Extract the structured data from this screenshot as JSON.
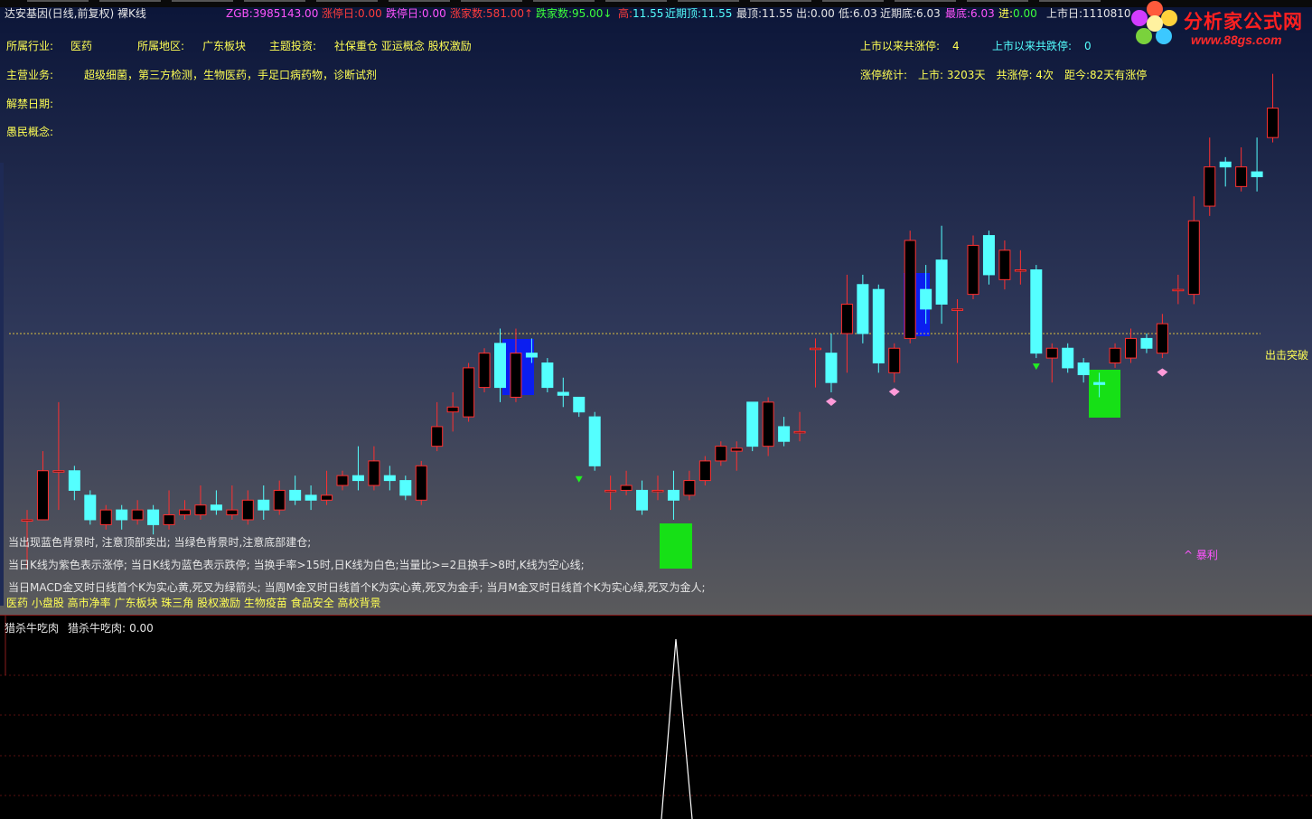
{
  "header": {
    "title": "达安基因(日线,前复权) 裸K线",
    "zgb_label": "ZGB:",
    "zgb_value": "3985143.00",
    "zt_label": "涨停日:",
    "zt_value": "0.00",
    "dt_label": "跌停日:",
    "dt_value": "0.00",
    "zjs_label": "涨家数:",
    "zjs_value": "581.00",
    "djs_label": "跌家数:",
    "djs_value": "95.00",
    "gao_label": "高:",
    "gao_value": "11.55",
    "jqd_label": "近期顶:",
    "jqd_value": "11.55",
    "zd_label": "最顶:",
    "zd_value": "11.55",
    "chu_label": "出:",
    "chu_value": "0.00",
    "di_label": "低:",
    "di_value": "6.03",
    "jqdi_label": "近期底:",
    "jqdi_value": "6.03",
    "zdi_label": "最底:",
    "zdi_value": "6.03",
    "jin_label": "进:",
    "jin_value": "0.00",
    "ssr_label": "上市日:",
    "ssr_value": "1110810"
  },
  "info": {
    "industry_label": "所属行业:",
    "industry_value": "医药",
    "region_label": "所属地区:",
    "region_value": "广东板块",
    "theme_label": "主题投资:",
    "theme_value": "社保重仓 亚运概念 股权激励",
    "business_label": "主营业务:",
    "business_value": "超级细菌，第三方检测，生物医药，手足口病药物，诊断试剂",
    "unban_label": "解禁日期:",
    "concept_label": "愚民概念:",
    "zt_total_label": "上市以来共涨停:",
    "zt_total_value": "4",
    "dt_total_label": "上市以来共跌停:",
    "dt_total_value": "0",
    "stat_label": "涨停统计:",
    "stat_listed": "上市: 3203天",
    "stat_count": "共涨停: 4次",
    "stat_since": "距今:82天有涨停"
  },
  "notes": {
    "line1": "当出现蓝色背景时, 注意顶部卖出; 当绿色背景时,注意底部建仓;",
    "line2": "当日K线为紫色表示涨停; 当日K线为蓝色表示跌停; 当换手率>15时,日K线为白色;当量比>=2且换手>8时,K线为空心线;",
    "line3": "当日MACD金叉时日线首个K为实心黄,死叉为绿箭头; 当周M金叉时日线首个K为实心黄,死叉为金手; 当月M金叉时日线首个K为实心绿,死叉为金人;",
    "tags": "医药 小盘股 高市净率 广东板块 珠三角 股权激励 生物疫苗 食品安全 高校背景",
    "breakout": "出击突破",
    "profit": "^ 暴利"
  },
  "indicator": {
    "title": "猎杀牛吃肉",
    "label": "猎杀牛吃肉:",
    "value": "0.00"
  },
  "logo": {
    "name": "分析家公式网",
    "url": "www.88gs.com"
  },
  "colors": {
    "up_body": "#000000",
    "up_line": "#ff3030",
    "down_body": "#54ffff",
    "limit_up": "#ff0000",
    "bg_top": "#0b1538",
    "bg_bottom": "#5a5a5c"
  },
  "chart_data": {
    "type": "candlestick",
    "breakout_level": 8.9,
    "candles": [
      {
        "o": 7.0,
        "c": 7.0,
        "h": 7.1,
        "l": 6.5
      },
      {
        "o": 7.0,
        "c": 7.5,
        "h": 7.7,
        "l": 7.0
      },
      {
        "o": 7.5,
        "c": 7.5,
        "h": 8.2,
        "l": 7.1
      },
      {
        "o": 7.5,
        "c": 7.3,
        "h": 7.55,
        "l": 7.2
      },
      {
        "o": 7.25,
        "c": 7.0,
        "h": 7.3,
        "l": 6.95
      },
      {
        "o": 6.95,
        "c": 7.1,
        "h": 7.15,
        "l": 6.9
      },
      {
        "o": 7.1,
        "c": 7.0,
        "h": 7.15,
        "l": 6.9
      },
      {
        "o": 7.0,
        "c": 7.1,
        "h": 7.2,
        "l": 6.95
      },
      {
        "o": 7.1,
        "c": 6.95,
        "h": 7.15,
        "l": 6.85
      },
      {
        "o": 6.95,
        "c": 7.05,
        "h": 7.3,
        "l": 6.9
      },
      {
        "o": 7.05,
        "c": 7.1,
        "h": 7.2,
        "l": 7.0
      },
      {
        "o": 7.05,
        "c": 7.15,
        "h": 7.35,
        "l": 7.0
      },
      {
        "o": 7.15,
        "c": 7.1,
        "h": 7.3,
        "l": 7.05
      },
      {
        "o": 7.05,
        "c": 7.1,
        "h": 7.35,
        "l": 7.0
      },
      {
        "o": 7.0,
        "c": 7.2,
        "h": 7.3,
        "l": 6.95
      },
      {
        "o": 7.2,
        "c": 7.1,
        "h": 7.35,
        "l": 7.0
      },
      {
        "o": 7.1,
        "c": 7.3,
        "h": 7.4,
        "l": 7.05
      },
      {
        "o": 7.3,
        "c": 7.2,
        "h": 7.45,
        "l": 7.15
      },
      {
        "o": 7.25,
        "c": 7.2,
        "h": 7.35,
        "l": 7.1
      },
      {
        "o": 7.2,
        "c": 7.25,
        "h": 7.5,
        "l": 7.15
      },
      {
        "o": 7.35,
        "c": 7.45,
        "h": 7.5,
        "l": 7.3
      },
      {
        "o": 7.45,
        "c": 7.4,
        "h": 7.75,
        "l": 7.3
      },
      {
        "o": 7.35,
        "c": 7.6,
        "h": 7.75,
        "l": 7.3
      },
      {
        "o": 7.45,
        "c": 7.4,
        "h": 7.55,
        "l": 7.3
      },
      {
        "o": 7.4,
        "c": 7.25,
        "h": 7.45,
        "l": 7.2
      },
      {
        "o": 7.2,
        "c": 7.55,
        "h": 7.6,
        "l": 7.15
      },
      {
        "o": 7.75,
        "c": 7.95,
        "h": 8.2,
        "l": 7.7
      },
      {
        "o": 8.1,
        "c": 8.15,
        "h": 8.3,
        "l": 7.9
      },
      {
        "o": 8.05,
        "c": 8.55,
        "h": 8.6,
        "l": 8.0
      },
      {
        "o": 8.35,
        "c": 8.7,
        "h": 8.75,
        "l": 8.3
      },
      {
        "o": 8.8,
        "c": 8.35,
        "h": 8.95,
        "l": 8.2
      },
      {
        "o": 8.25,
        "c": 8.7,
        "h": 8.95,
        "l": 8.2
      },
      {
        "o": 8.7,
        "c": 8.66,
        "h": 8.85,
        "l": 8.6
      },
      {
        "o": 8.6,
        "c": 8.35,
        "h": 8.65,
        "l": 8.3
      },
      {
        "o": 8.3,
        "c": 8.27,
        "h": 8.45,
        "l": 8.15
      },
      {
        "o": 8.25,
        "c": 8.1,
        "h": 8.25,
        "l": 8.05
      },
      {
        "o": 8.05,
        "c": 7.55,
        "h": 8.1,
        "l": 7.5
      },
      {
        "o": 7.3,
        "c": 7.3,
        "h": 7.45,
        "l": 7.1
      },
      {
        "o": 7.3,
        "c": 7.35,
        "h": 7.5,
        "l": 7.25
      },
      {
        "o": 7.3,
        "c": 7.1,
        "h": 7.4,
        "l": 7.05
      },
      {
        "o": 7.3,
        "c": 7.3,
        "h": 7.45,
        "l": 7.2
      },
      {
        "o": 7.3,
        "c": 7.2,
        "h": 7.5,
        "l": 7.0
      },
      {
        "o": 7.25,
        "c": 7.4,
        "h": 7.5,
        "l": 7.2
      },
      {
        "o": 7.4,
        "c": 7.6,
        "h": 7.65,
        "l": 7.35
      },
      {
        "o": 7.6,
        "c": 7.75,
        "h": 7.8,
        "l": 7.55
      },
      {
        "o": 7.7,
        "c": 7.73,
        "h": 7.8,
        "l": 7.5
      },
      {
        "o": 8.2,
        "c": 7.75,
        "h": 8.2,
        "l": 7.7
      },
      {
        "o": 7.75,
        "c": 8.2,
        "h": 8.25,
        "l": 7.65
      },
      {
        "o": 7.95,
        "c": 7.8,
        "h": 8.05,
        "l": 7.75
      },
      {
        "o": 7.9,
        "c": 7.9,
        "h": 8.1,
        "l": 7.8
      },
      {
        "o": 8.75,
        "c": 8.75,
        "h": 8.85,
        "l": 8.35
      },
      {
        "o": 8.7,
        "c": 8.4,
        "h": 8.9,
        "l": 8.3
      },
      {
        "o": 8.9,
        "c": 9.2,
        "h": 9.5,
        "l": 8.5
      },
      {
        "o": 9.4,
        "c": 8.9,
        "h": 9.5,
        "l": 8.8
      },
      {
        "o": 9.35,
        "c": 8.6,
        "h": 9.4,
        "l": 8.5
      },
      {
        "o": 8.5,
        "c": 8.75,
        "h": 8.8,
        "l": 8.4
      },
      {
        "o": 8.85,
        "c": 9.85,
        "h": 9.95,
        "l": 8.8
      },
      {
        "o": 9.35,
        "c": 9.15,
        "h": 9.6,
        "l": 9.0
      },
      {
        "o": 9.65,
        "c": 9.2,
        "h": 10.0,
        "l": 9.0
      },
      {
        "o": 9.15,
        "c": 9.15,
        "h": 9.25,
        "l": 8.6
      },
      {
        "o": 9.3,
        "c": 9.8,
        "h": 9.9,
        "l": 9.25
      },
      {
        "o": 9.9,
        "c": 9.5,
        "h": 9.95,
        "l": 9.4
      },
      {
        "o": 9.45,
        "c": 9.75,
        "h": 9.85,
        "l": 9.35
      },
      {
        "o": 9.55,
        "c": 9.55,
        "h": 9.75,
        "l": 9.4
      },
      {
        "o": 9.55,
        "c": 8.7,
        "h": 9.6,
        "l": 8.65
      },
      {
        "o": 8.65,
        "c": 8.75,
        "h": 8.8,
        "l": 8.4
      },
      {
        "o": 8.75,
        "c": 8.55,
        "h": 8.8,
        "l": 8.5
      },
      {
        "o": 8.6,
        "c": 8.48,
        "h": 8.65,
        "l": 8.4
      },
      {
        "o": 8.4,
        "c": 8.38,
        "h": 8.5,
        "l": 8.25
      },
      {
        "o": 8.6,
        "c": 8.75,
        "h": 8.8,
        "l": 8.55
      },
      {
        "o": 8.65,
        "c": 8.85,
        "h": 8.95,
        "l": 8.6
      },
      {
        "o": 8.85,
        "c": 8.75,
        "h": 8.9,
        "l": 8.7
      },
      {
        "o": 8.7,
        "c": 9.0,
        "h": 9.1,
        "l": 8.65
      },
      {
        "o": 9.35,
        "c": 9.35,
        "h": 9.5,
        "l": 9.2
      },
      {
        "o": 9.3,
        "c": 10.05,
        "h": 10.3,
        "l": 9.2
      },
      {
        "o": 10.2,
        "c": 10.6,
        "h": 10.9,
        "l": 10.1
      },
      {
        "o": 10.65,
        "c": 10.6,
        "h": 10.7,
        "l": 10.4
      },
      {
        "o": 10.4,
        "c": 10.6,
        "h": 10.8,
        "l": 10.35
      },
      {
        "o": 10.55,
        "c": 10.5,
        "h": 10.9,
        "l": 10.35
      },
      {
        "o": 10.9,
        "c": 11.2,
        "h": 11.55,
        "l": 10.85
      }
    ]
  }
}
